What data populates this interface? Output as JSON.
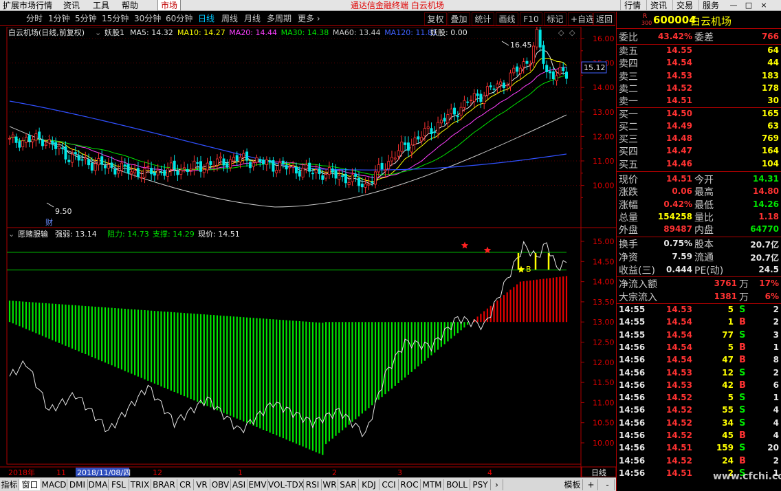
{
  "topmenu": {
    "items": [
      "扩展市场行情",
      "资讯",
      "工具",
      "帮助"
    ],
    "active_tab": "市场",
    "app_title": "通达信金融终端  白云机场",
    "right_items": [
      "行情",
      "资讯",
      "交易",
      "服务"
    ],
    "win_buttons": [
      "—",
      "□",
      "×"
    ]
  },
  "periodbar": {
    "periods": [
      "分时",
      "1分钟",
      "5分钟",
      "15分钟",
      "30分钟",
      "60分钟",
      "日线",
      "周线",
      "月线",
      "多周期",
      "更多 ›"
    ],
    "active_period": "日线",
    "tools": [
      "复权",
      "叠加",
      "统计",
      "画线",
      "F10",
      "标记",
      "+自选",
      "返回"
    ]
  },
  "main_chart": {
    "stock_label": "白云机场(日线,前复权)",
    "indicator_label": "妖股1",
    "ma_items": [
      {
        "label": "MA5: 14.32",
        "color": "#e6e6e6"
      },
      {
        "label": "MA10: 14.27",
        "color": "#ffff00"
      },
      {
        "label": "MA20: 14.44",
        "color": "#ff40ff"
      },
      {
        "label": "MA30: 14.38",
        "color": "#00e600"
      },
      {
        "label": "MA60: 13.44",
        "color": "#c8c8c8"
      },
      {
        "label": "MA120: 11.81",
        "color": "#4060ff"
      }
    ],
    "yao_label": "妖股: 0.00",
    "price_ticks": [
      "16.00",
      "15.00",
      "14.00",
      "13.00",
      "12.00",
      "11.00",
      "10.00"
    ],
    "current_price_tag": "15.12",
    "high_label": "16.45",
    "low_label": "9.50",
    "cai_label": "财"
  },
  "sub_chart": {
    "indicator": "愿赌服输",
    "strength": "强弱: 13.14",
    "resistance": "阻力: 14.73",
    "support": "支撑: 14.29",
    "current": "现价: 14.51",
    "ticks": [
      "15.00",
      "14.50",
      "14.00",
      "13.50",
      "13.00",
      "12.50",
      "12.00",
      "11.50",
      "11.00",
      "10.50",
      "10.00"
    ],
    "b_label": "B"
  },
  "timeaxis": {
    "labels": [
      "2018年",
      "11",
      "2018/11/08/四",
      "12",
      "1",
      "2",
      "3",
      "4"
    ],
    "period_label": "日线"
  },
  "tabs": {
    "items": [
      "指标",
      "窗口",
      "MACD",
      "DMI",
      "DMA",
      "FSL",
      "TRIX",
      "BRAR",
      "CR",
      "VR",
      "OBV",
      "ASI",
      "EMV",
      "VOL-TDX",
      "RSI",
      "WR",
      "SAR",
      "KDJ",
      "CCI",
      "ROC",
      "MTM",
      "BOLL",
      "PSY",
      "›"
    ],
    "template_label": "模板",
    "right_buttons": [
      "+",
      "-"
    ]
  },
  "quote": {
    "code": "600004",
    "name": "白云机场",
    "badge_r": "R",
    "badge_300": "300",
    "weibi_label": "委比",
    "weibi": "43.42%",
    "weicha_label": "委差",
    "weicha": "766",
    "sell": [
      {
        "label": "卖五",
        "price": "14.55",
        "vol": "64"
      },
      {
        "label": "卖四",
        "price": "14.54",
        "vol": "44"
      },
      {
        "label": "卖三",
        "price": "14.53",
        "vol": "183"
      },
      {
        "label": "卖二",
        "price": "14.52",
        "vol": "178"
      },
      {
        "label": "卖一",
        "price": "14.51",
        "vol": "30"
      }
    ],
    "buy": [
      {
        "label": "买一",
        "price": "14.50",
        "vol": "165"
      },
      {
        "label": "买二",
        "price": "14.49",
        "vol": "63"
      },
      {
        "label": "买三",
        "price": "14.48",
        "vol": "769"
      },
      {
        "label": "买四",
        "price": "14.47",
        "vol": "164"
      },
      {
        "label": "买五",
        "price": "14.46",
        "vol": "104"
      }
    ],
    "stats": [
      {
        "k1": "现价",
        "v1": "14.51",
        "c1": "red",
        "k2": "今开",
        "v2": "14.31",
        "c2": "green"
      },
      {
        "k1": "涨跌",
        "v1": "0.06",
        "c1": "red",
        "k2": "最高",
        "v2": "14.80",
        "c2": "red"
      },
      {
        "k1": "涨幅",
        "v1": "0.42%",
        "c1": "red",
        "k2": "最低",
        "v2": "14.26",
        "c2": "green"
      },
      {
        "k1": "总量",
        "v1": "154258",
        "c1": "yellow",
        "k2": "量比",
        "v2": "1.18",
        "c2": "red"
      },
      {
        "k1": "外盘",
        "v1": "89487",
        "c1": "red",
        "k2": "内盘",
        "v2": "64770",
        "c2": "green"
      }
    ],
    "stats2": [
      {
        "k1": "换手",
        "v1": "0.75%",
        "c1": "white",
        "k2": "股本",
        "v2": "20.7亿",
        "c2": "white"
      },
      {
        "k1": "净资",
        "v1": "7.59",
        "c1": "white",
        "k2": "流通",
        "v2": "20.7亿",
        "c2": "white"
      },
      {
        "k1": "收益(三)",
        "v1": "0.444",
        "c1": "white",
        "k2": "PE(动)",
        "v2": "24.5",
        "c2": "white"
      }
    ],
    "flows": [
      {
        "k": "净流入额",
        "v": "3761",
        "unit": "万",
        "pct": "17%"
      },
      {
        "k": "大宗流入",
        "v": "1381",
        "unit": "万",
        "pct": "6%"
      }
    ],
    "ticks": [
      {
        "t": "14:55",
        "p": "14.53",
        "v": "5",
        "s": "S",
        "n": "2"
      },
      {
        "t": "14:55",
        "p": "14.54",
        "v": "1",
        "s": "B",
        "n": "2"
      },
      {
        "t": "14:55",
        "p": "14.54",
        "v": "77",
        "s": "S",
        "n": "3"
      },
      {
        "t": "14:56",
        "p": "14.54",
        "v": "5",
        "s": "B",
        "n": "1"
      },
      {
        "t": "14:56",
        "p": "14.54",
        "v": "47",
        "s": "B",
        "n": "8"
      },
      {
        "t": "14:56",
        "p": "14.53",
        "v": "12",
        "s": "S",
        "n": "2"
      },
      {
        "t": "14:56",
        "p": "14.53",
        "v": "42",
        "s": "B",
        "n": "6"
      },
      {
        "t": "14:56",
        "p": "14.52",
        "v": "5",
        "s": "S",
        "n": "1"
      },
      {
        "t": "14:56",
        "p": "14.52",
        "v": "55",
        "s": "S",
        "n": "4"
      },
      {
        "t": "14:56",
        "p": "14.52",
        "v": "34",
        "s": "S",
        "n": "4"
      },
      {
        "t": "14:56",
        "p": "14.52",
        "v": "45",
        "s": "B",
        "n": "4"
      },
      {
        "t": "14:56",
        "p": "14.51",
        "v": "159",
        "s": "S",
        "n": "20"
      },
      {
        "t": "14:56",
        "p": "14.52",
        "v": "24",
        "s": "B",
        "n": "2"
      },
      {
        "t": "14:56",
        "p": "14.51",
        "v": "2",
        "s": "S",
        "n": "1"
      }
    ]
  },
  "watermark": "www.cfchi.com"
}
